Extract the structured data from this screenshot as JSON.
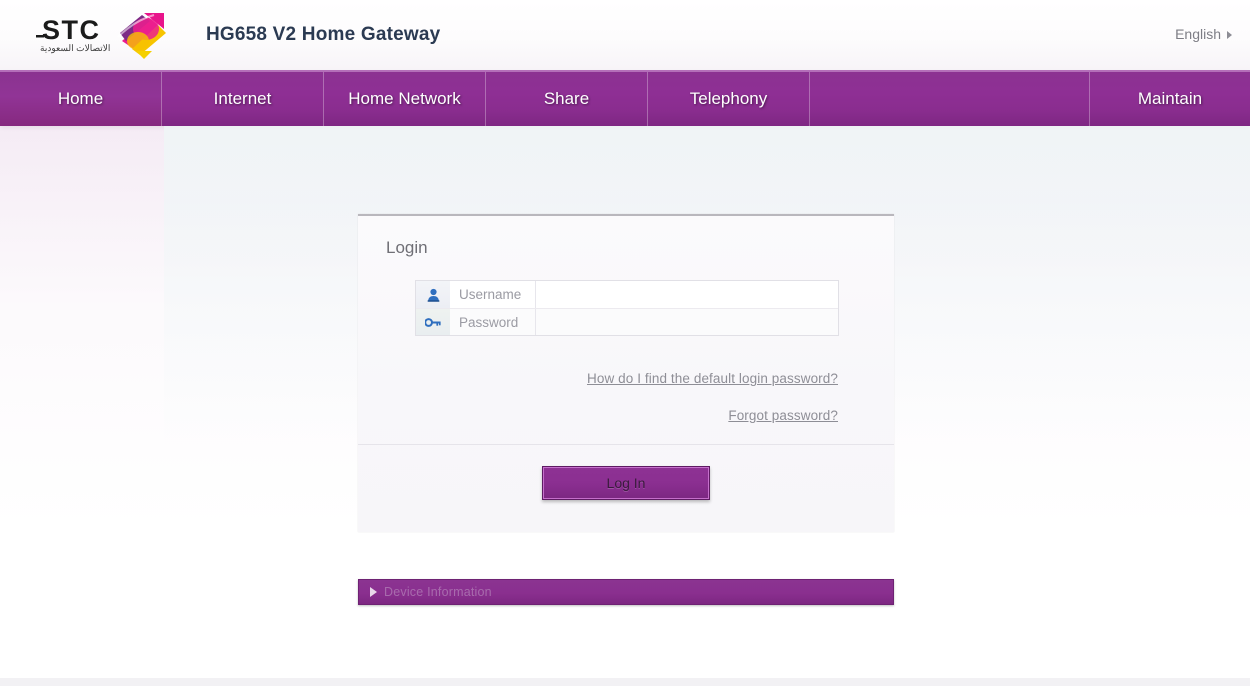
{
  "header": {
    "logo_alt": "STC",
    "logo_text": "STC",
    "logo_subtext": "الاتصالات السعودية",
    "product_title": "HG658 V2 Home Gateway",
    "language": {
      "label": "English",
      "arrow_icon": "triangle-right-icon"
    }
  },
  "nav": {
    "items": [
      {
        "label": "Home",
        "active": true
      },
      {
        "label": "Internet",
        "active": false
      },
      {
        "label": "Home Network",
        "active": false
      },
      {
        "label": "Share",
        "active": false
      },
      {
        "label": "Telephony",
        "active": false
      },
      {
        "label": "",
        "active": false
      },
      {
        "label": "Maintain",
        "active": false
      }
    ]
  },
  "login": {
    "title": "Login",
    "username": {
      "icon": "user-icon",
      "label": "Username",
      "value": "",
      "placeholder": ""
    },
    "password": {
      "icon": "key-icon",
      "label": "Password",
      "value": "",
      "placeholder": ""
    },
    "help_link": "How do I find the default login password?",
    "forgot_link": "Forgot password?",
    "submit_label": "Log In"
  },
  "device_info": {
    "label": "Device Information",
    "arrow_icon": "triangle-right-icon"
  },
  "colors": {
    "brand_purple": "#8b2f91",
    "nav_purple_light": "#913496",
    "nav_border_light": "#b46fb9",
    "title_navy": "#2b3a52",
    "link_gray": "#8e8e96",
    "panel_bg": "#f8f7fa"
  }
}
